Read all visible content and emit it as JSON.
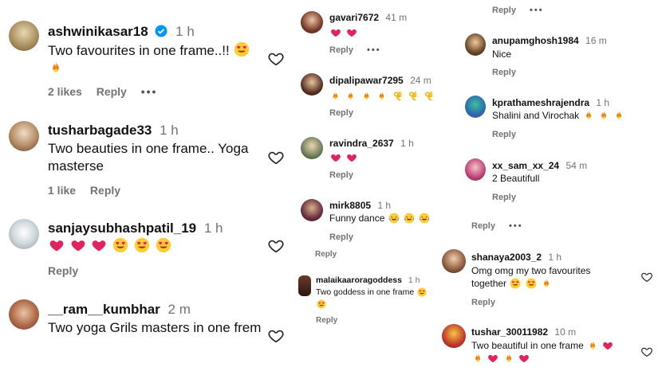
{
  "panel1": {
    "comments": [
      {
        "user": "ashwinikasar18",
        "time": "1 h",
        "text": "Two favourites in one frame..!!",
        "likes": "2 likes",
        "reply": "Reply",
        "more": "•••"
      },
      {
        "user": "tusharbagade33",
        "time": "1 h",
        "text": "Two beauties in one frame.. Yoga masterse",
        "likes": "1 like",
        "reply": "Reply"
      },
      {
        "user": "sanjaysubhashpatil_19",
        "time": "1 h",
        "text": "",
        "reply": "Reply"
      },
      {
        "user": "__ram__kumbhar",
        "time": "2 m",
        "text": "Two yoga Grils masters in one frem"
      }
    ]
  },
  "panel2": {
    "comments": [
      {
        "user": "gavari7672",
        "time": "41 m",
        "reply": "Reply",
        "more": "•••"
      },
      {
        "user": "dipalipawar7295",
        "time": "24 m",
        "reply": "Reply"
      },
      {
        "user": "ravindra_2637",
        "time": "1 h",
        "reply": "Reply"
      },
      {
        "user": "mirk8805",
        "time": "1 h",
        "text": "Funny dance",
        "reply": "Reply",
        "reply2": "Reply"
      },
      {
        "user": "malaikaaroragoddess",
        "time": "1 h",
        "text": "Two goddess in one frame",
        "reply": "Reply"
      }
    ]
  },
  "panel3": {
    "top": {
      "reply": "Reply",
      "more": "•••"
    },
    "comments": [
      {
        "user": "anupamghosh1984",
        "time": "16 m",
        "text": "Nice",
        "reply": "Reply"
      },
      {
        "user": "kprathameshrajendra",
        "time": "1 h",
        "text": "Shalini and Virochak",
        "reply": "Reply"
      },
      {
        "user": "xx_sam_xx_24",
        "time": "54 m",
        "text": "2 Beautifull",
        "reply": "Reply"
      },
      {
        "user": "",
        "time": "",
        "text": "",
        "reply": "Reply",
        "more": "•••"
      },
      {
        "user": "shanaya2003_2",
        "time": "1 h",
        "text": "Omg omg my two favourites together",
        "reply": "Reply"
      },
      {
        "user": "tushar_30011982",
        "time": "10 m",
        "text": "Two beautiful in one frame"
      }
    ]
  },
  "colors": {
    "heart": "#e0245e",
    "fire": "#f57c00",
    "verified": "#0095f6",
    "meta": "#737373"
  }
}
